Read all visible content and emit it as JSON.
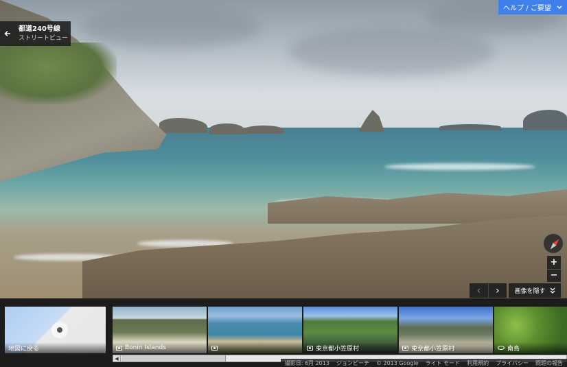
{
  "header": {
    "back_icon": "arrow-left-icon",
    "title": "都道240号線",
    "subtitle": "ストリートビュー"
  },
  "help": {
    "label": "ヘルプ / ご要望",
    "icon": "chevron-down-icon",
    "color": "#3f80ea"
  },
  "controls": {
    "compass_icon": "compass-icon",
    "zoom_in": "+",
    "zoom_out": "−",
    "prev": "‹",
    "next": "›",
    "hide_images": "画像を隠す",
    "hide_icon": "double-chevron-down-icon"
  },
  "filmstrip": {
    "items": [
      {
        "label": "地図に戻る",
        "icon": ""
      },
      {
        "label": "Bonin Islands",
        "icon": "camera-icon"
      },
      {
        "label": "",
        "icon": "camera-icon"
      },
      {
        "label": "東京都小笠原村",
        "icon": "camera-icon"
      },
      {
        "label": "東京都小笠原村",
        "icon": "camera-icon"
      },
      {
        "label": "南島",
        "icon": "eye-icon"
      }
    ]
  },
  "footer": {
    "date": "撮影日: 6月 2013",
    "place": "ジョンビーチ",
    "copyright": "© 2013 Google",
    "lite_mode": "ライト モード",
    "terms": "利用規約",
    "privacy": "プライバシー",
    "report": "問題の報告"
  }
}
